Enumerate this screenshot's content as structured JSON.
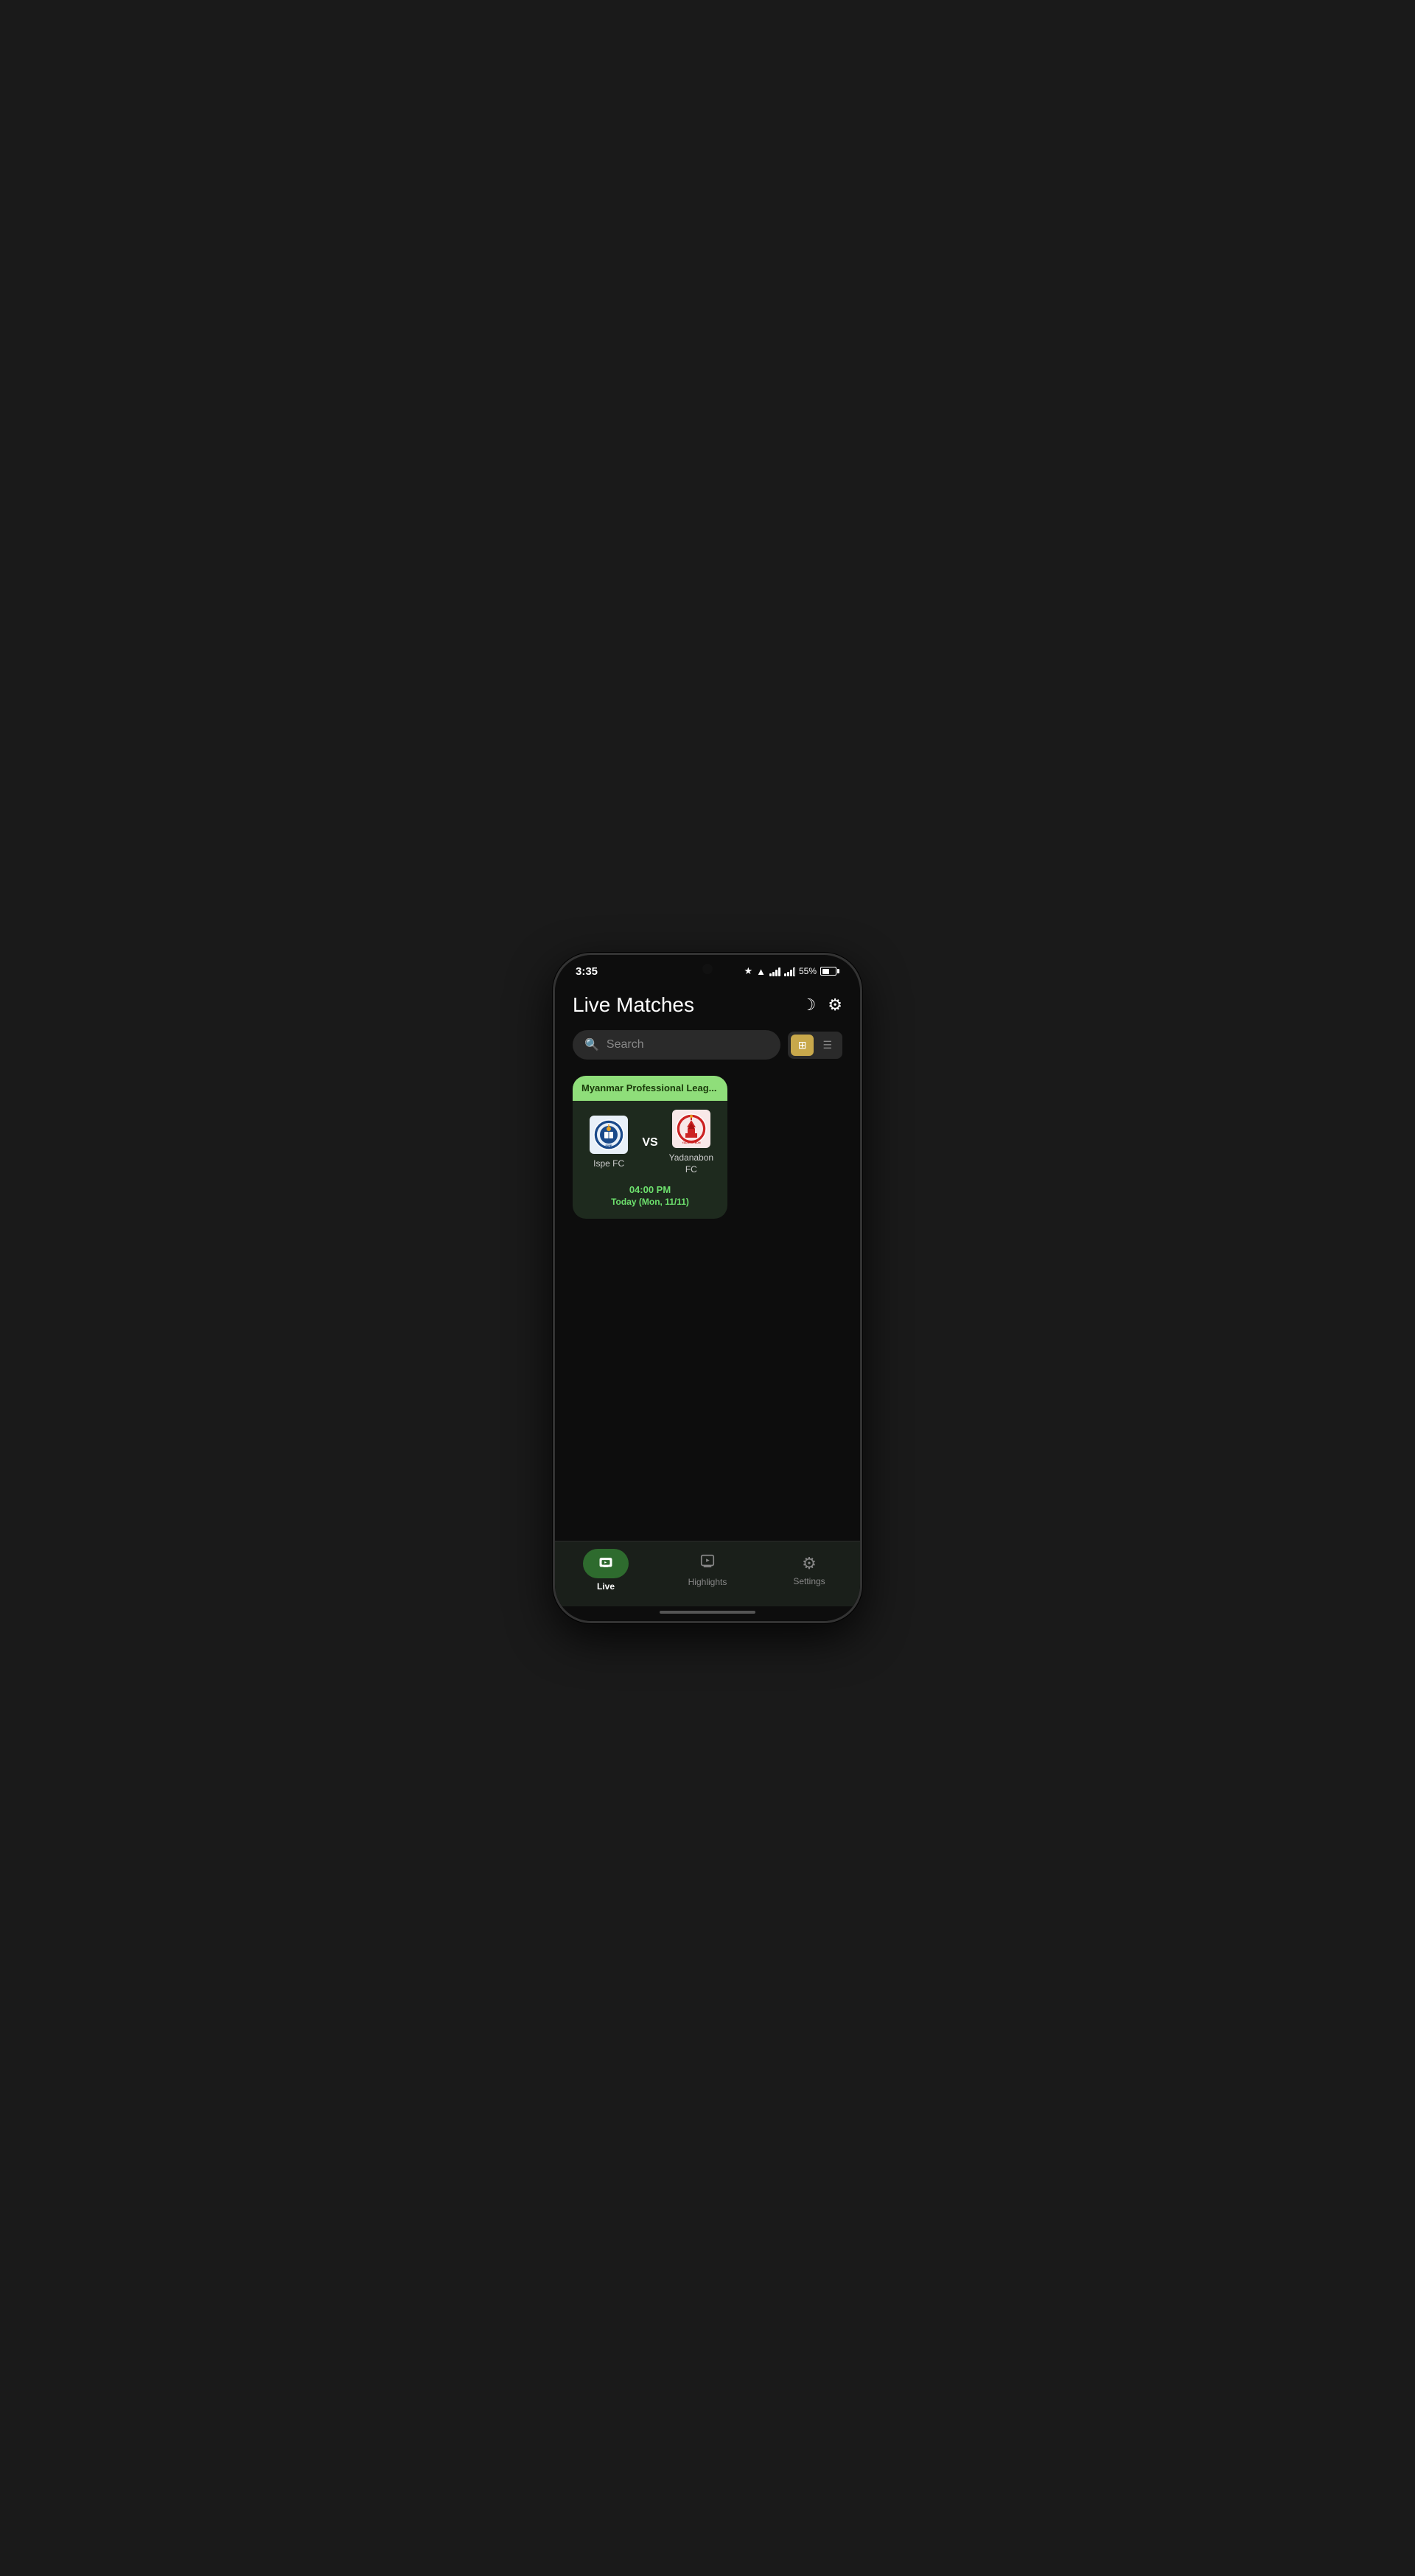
{
  "statusBar": {
    "time": "3:35",
    "battery": "55%"
  },
  "header": {
    "title": "Live Matches",
    "moonIconLabel": "moon",
    "settingsIconLabel": "settings"
  },
  "search": {
    "placeholder": "Search"
  },
  "viewToggle": {
    "gridLabel": "⊞",
    "listLabel": "☰",
    "activeView": "grid"
  },
  "matches": [
    {
      "league": "Myanmar Professional Leag...",
      "team1Name": "Ispe FC",
      "team2Name": "Yadanabon FC",
      "vsLabel": "VS",
      "time": "04:00 PM",
      "date": "Today (Mon, 11/11)"
    }
  ],
  "bottomNav": {
    "items": [
      {
        "id": "live",
        "label": "Live",
        "active": true
      },
      {
        "id": "highlights",
        "label": "Highlights",
        "active": false
      },
      {
        "id": "settings",
        "label": "Settings",
        "active": false
      }
    ]
  }
}
